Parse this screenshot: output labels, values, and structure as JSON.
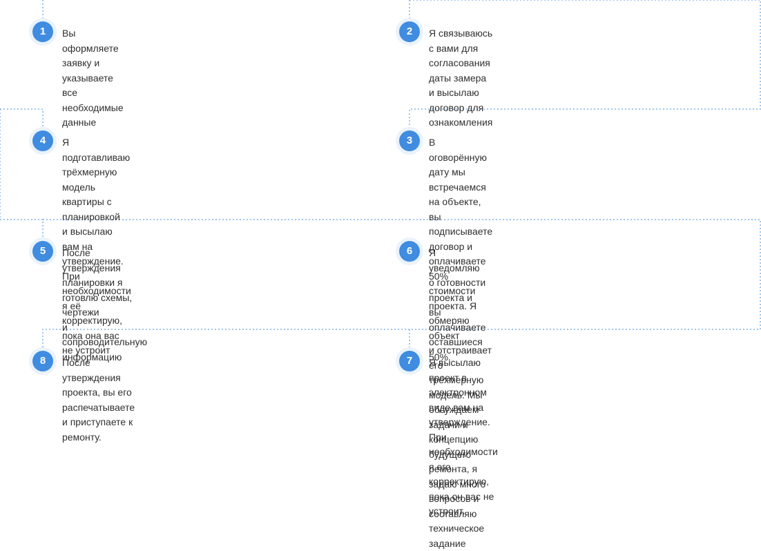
{
  "colors": {
    "accent": "#3f8ce0",
    "badge_ring": "#eaf2fb",
    "connector": "#7fb2ea"
  },
  "steps": [
    {
      "number": "1",
      "text": "Вы оформляете заявку и указываете все необходимые данные"
    },
    {
      "number": "2",
      "text": "Я связываюсь с вами для согласования даты замера\nи высылаю договор для ознакомления"
    },
    {
      "number": "4",
      "text": "Я подготавливаю трёхмерную модель квартиры с планировкой\nи высылаю вам на утверждение. При необходимости я её\nкорректирую, пока она вас не устроит"
    },
    {
      "number": "3",
      "text": "В оговорённую дату мы встречаемся на объекте, вы подписываете\nдоговор и оплачиваете 50% стоимости проекта. Я обмеряю объект\nи отстраивает его трёхмерную модель. Мы обсуждаем задачи и\nконцепцию будущего ремонта, я задаю много вопросов и\nсоставляю техническое задание"
    },
    {
      "number": "5",
      "text": "После утверждения планировки я готовлю схемы, чертежи\nи сопроводительную информацию"
    },
    {
      "number": "6",
      "text": "Я уведомляю о готовности проекта и вы оплачиваете\nоставшиеся 50%."
    },
    {
      "number": "8",
      "text": "После утверждения проекта, вы его распечатываете\nи приступаете к ремонту."
    },
    {
      "number": "7",
      "text": "Я высылаю проект в электронном виде вам на утверждение.\nПри необходимости я его корректирую, пока он вас не\nустроит."
    }
  ]
}
